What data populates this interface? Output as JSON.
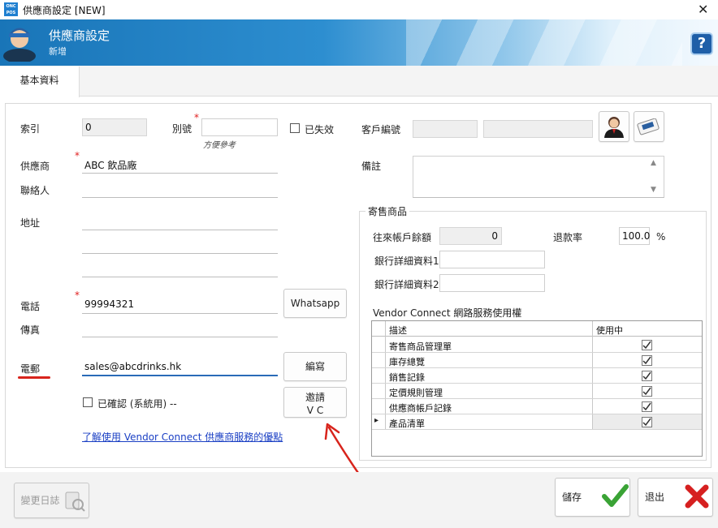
{
  "window": {
    "app_icon": "ONC POS",
    "title": "供應商設定 [NEW]",
    "close": "✕"
  },
  "banner": {
    "title": "供應商設定",
    "subtitle": "新增",
    "help": "?"
  },
  "tabs": [
    {
      "label": "基本資料"
    }
  ],
  "form": {
    "index_label": "索引",
    "index_value": "0",
    "alias_label": "別號",
    "alias_value": "",
    "alias_hint": "方便參考",
    "inactive_label": "已失效",
    "customer_no_label": "客戶編號",
    "supplier_label": "供應商",
    "supplier_value": "ABC 飲品廠",
    "contact_label": "聯絡人",
    "contact_value": "",
    "address_label": "地址",
    "notes_label": "備註",
    "phone_label": "電話",
    "phone_value": "99994321",
    "fax_label": "傳真",
    "fax_value": "",
    "email_label": "電郵",
    "email_value": "sales@abcdrinks.hk",
    "confirmed_label": "已確認 (系統用) --",
    "whatsapp_button": "Whatsapp",
    "compose_button": "編寫",
    "invite_button_line1": "邀請",
    "invite_button_line2": "V C",
    "vc_link": "了解使用 Vendor Connect 供應商服務的優點",
    "required_mark": "*"
  },
  "consignment": {
    "group_title": "寄售商品",
    "balance_label": "往來帳戶餘額",
    "balance_value": "0",
    "refund_label": "退款率",
    "refund_value": "100.0",
    "refund_unit": "%",
    "bank1_label": "銀行詳細資料1",
    "bank2_label": "銀行詳細資料2",
    "vc_title": "Vendor Connect  網路服務使用權",
    "grid_headers": [
      "描述",
      "使用中"
    ],
    "grid_rows": [
      {
        "desc": "寄售商品管理單",
        "checked": true
      },
      {
        "desc": "庫存總覽",
        "checked": true
      },
      {
        "desc": "銷售記錄",
        "checked": true
      },
      {
        "desc": "定價規則管理",
        "checked": true
      },
      {
        "desc": "供應商帳戶記錄",
        "checked": true
      },
      {
        "desc": "產品清單",
        "checked": true
      }
    ],
    "current_row_marker": "▸"
  },
  "footer": {
    "changelog_button": "變更日誌",
    "save_button": "儲存",
    "exit_button": "退出"
  },
  "colors": {
    "accent": "#1975b8",
    "required": "#e02020",
    "underline": "#d8241c",
    "save_check": "#3aa335",
    "exit_x": "#d62020",
    "link": "#1a3fc4"
  },
  "icons": [
    "user-avatar-icon",
    "help-icon",
    "person-icon",
    "card-icon",
    "checkmark-icon",
    "close-x-icon",
    "changelog-icon",
    "scroll-up-icon",
    "scroll-down-icon"
  ]
}
